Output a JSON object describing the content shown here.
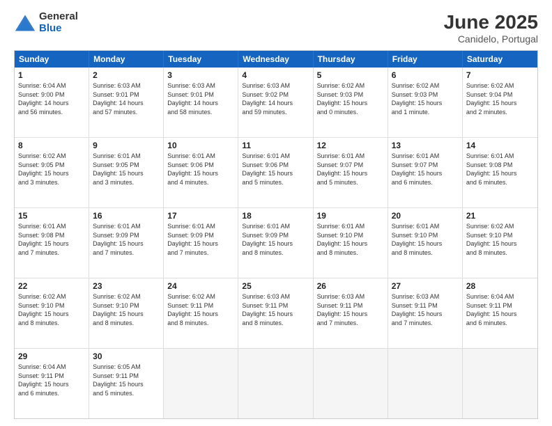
{
  "logo": {
    "general": "General",
    "blue": "Blue"
  },
  "header": {
    "month": "June 2025",
    "location": "Canidelo, Portugal"
  },
  "weekdays": [
    "Sunday",
    "Monday",
    "Tuesday",
    "Wednesday",
    "Thursday",
    "Friday",
    "Saturday"
  ],
  "rows": [
    [
      {
        "day": "1",
        "lines": [
          "Sunrise: 6:04 AM",
          "Sunset: 9:00 PM",
          "Daylight: 14 hours",
          "and 56 minutes."
        ]
      },
      {
        "day": "2",
        "lines": [
          "Sunrise: 6:03 AM",
          "Sunset: 9:01 PM",
          "Daylight: 14 hours",
          "and 57 minutes."
        ]
      },
      {
        "day": "3",
        "lines": [
          "Sunrise: 6:03 AM",
          "Sunset: 9:01 PM",
          "Daylight: 14 hours",
          "and 58 minutes."
        ]
      },
      {
        "day": "4",
        "lines": [
          "Sunrise: 6:03 AM",
          "Sunset: 9:02 PM",
          "Daylight: 14 hours",
          "and 59 minutes."
        ]
      },
      {
        "day": "5",
        "lines": [
          "Sunrise: 6:02 AM",
          "Sunset: 9:03 PM",
          "Daylight: 15 hours",
          "and 0 minutes."
        ]
      },
      {
        "day": "6",
        "lines": [
          "Sunrise: 6:02 AM",
          "Sunset: 9:03 PM",
          "Daylight: 15 hours",
          "and 1 minute."
        ]
      },
      {
        "day": "7",
        "lines": [
          "Sunrise: 6:02 AM",
          "Sunset: 9:04 PM",
          "Daylight: 15 hours",
          "and 2 minutes."
        ]
      }
    ],
    [
      {
        "day": "8",
        "lines": [
          "Sunrise: 6:02 AM",
          "Sunset: 9:05 PM",
          "Daylight: 15 hours",
          "and 3 minutes."
        ]
      },
      {
        "day": "9",
        "lines": [
          "Sunrise: 6:01 AM",
          "Sunset: 9:05 PM",
          "Daylight: 15 hours",
          "and 3 minutes."
        ]
      },
      {
        "day": "10",
        "lines": [
          "Sunrise: 6:01 AM",
          "Sunset: 9:06 PM",
          "Daylight: 15 hours",
          "and 4 minutes."
        ]
      },
      {
        "day": "11",
        "lines": [
          "Sunrise: 6:01 AM",
          "Sunset: 9:06 PM",
          "Daylight: 15 hours",
          "and 5 minutes."
        ]
      },
      {
        "day": "12",
        "lines": [
          "Sunrise: 6:01 AM",
          "Sunset: 9:07 PM",
          "Daylight: 15 hours",
          "and 5 minutes."
        ]
      },
      {
        "day": "13",
        "lines": [
          "Sunrise: 6:01 AM",
          "Sunset: 9:07 PM",
          "Daylight: 15 hours",
          "and 6 minutes."
        ]
      },
      {
        "day": "14",
        "lines": [
          "Sunrise: 6:01 AM",
          "Sunset: 9:08 PM",
          "Daylight: 15 hours",
          "and 6 minutes."
        ]
      }
    ],
    [
      {
        "day": "15",
        "lines": [
          "Sunrise: 6:01 AM",
          "Sunset: 9:08 PM",
          "Daylight: 15 hours",
          "and 7 minutes."
        ]
      },
      {
        "day": "16",
        "lines": [
          "Sunrise: 6:01 AM",
          "Sunset: 9:09 PM",
          "Daylight: 15 hours",
          "and 7 minutes."
        ]
      },
      {
        "day": "17",
        "lines": [
          "Sunrise: 6:01 AM",
          "Sunset: 9:09 PM",
          "Daylight: 15 hours",
          "and 7 minutes."
        ]
      },
      {
        "day": "18",
        "lines": [
          "Sunrise: 6:01 AM",
          "Sunset: 9:09 PM",
          "Daylight: 15 hours",
          "and 8 minutes."
        ]
      },
      {
        "day": "19",
        "lines": [
          "Sunrise: 6:01 AM",
          "Sunset: 9:10 PM",
          "Daylight: 15 hours",
          "and 8 minutes."
        ]
      },
      {
        "day": "20",
        "lines": [
          "Sunrise: 6:01 AM",
          "Sunset: 9:10 PM",
          "Daylight: 15 hours",
          "and 8 minutes."
        ]
      },
      {
        "day": "21",
        "lines": [
          "Sunrise: 6:02 AM",
          "Sunset: 9:10 PM",
          "Daylight: 15 hours",
          "and 8 minutes."
        ]
      }
    ],
    [
      {
        "day": "22",
        "lines": [
          "Sunrise: 6:02 AM",
          "Sunset: 9:10 PM",
          "Daylight: 15 hours",
          "and 8 minutes."
        ]
      },
      {
        "day": "23",
        "lines": [
          "Sunrise: 6:02 AM",
          "Sunset: 9:10 PM",
          "Daylight: 15 hours",
          "and 8 minutes."
        ]
      },
      {
        "day": "24",
        "lines": [
          "Sunrise: 6:02 AM",
          "Sunset: 9:11 PM",
          "Daylight: 15 hours",
          "and 8 minutes."
        ]
      },
      {
        "day": "25",
        "lines": [
          "Sunrise: 6:03 AM",
          "Sunset: 9:11 PM",
          "Daylight: 15 hours",
          "and 8 minutes."
        ]
      },
      {
        "day": "26",
        "lines": [
          "Sunrise: 6:03 AM",
          "Sunset: 9:11 PM",
          "Daylight: 15 hours",
          "and 7 minutes."
        ]
      },
      {
        "day": "27",
        "lines": [
          "Sunrise: 6:03 AM",
          "Sunset: 9:11 PM",
          "Daylight: 15 hours",
          "and 7 minutes."
        ]
      },
      {
        "day": "28",
        "lines": [
          "Sunrise: 6:04 AM",
          "Sunset: 9:11 PM",
          "Daylight: 15 hours",
          "and 6 minutes."
        ]
      }
    ],
    [
      {
        "day": "29",
        "lines": [
          "Sunrise: 6:04 AM",
          "Sunset: 9:11 PM",
          "Daylight: 15 hours",
          "and 6 minutes."
        ]
      },
      {
        "day": "30",
        "lines": [
          "Sunrise: 6:05 AM",
          "Sunset: 9:11 PM",
          "Daylight: 15 hours",
          "and 5 minutes."
        ]
      },
      {
        "day": "",
        "lines": []
      },
      {
        "day": "",
        "lines": []
      },
      {
        "day": "",
        "lines": []
      },
      {
        "day": "",
        "lines": []
      },
      {
        "day": "",
        "lines": []
      }
    ]
  ]
}
